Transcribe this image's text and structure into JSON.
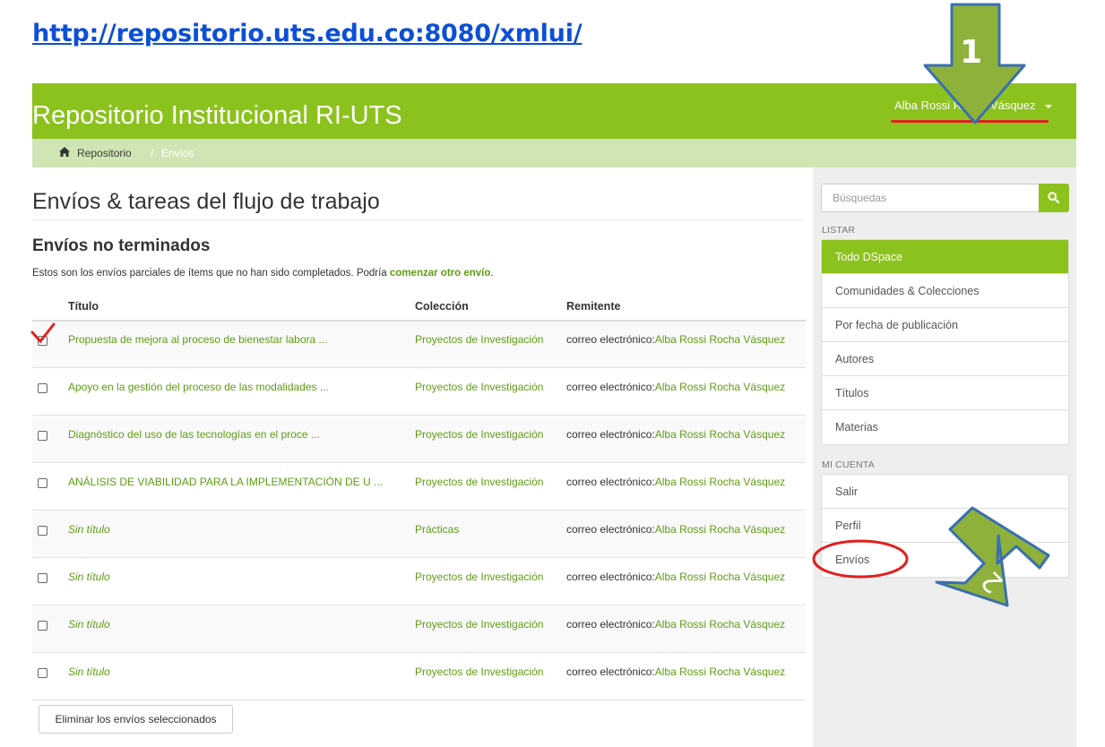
{
  "url_banner": "http://repositorio.uts.edu.co:8080/xmlui/",
  "header": {
    "brand": "Repositorio Institucional RI-UTS",
    "user_name": "Alba Rossi Rocha Vásquez",
    "accent_color": "#8cc21d"
  },
  "breadcrumb": {
    "home_icon": "home-icon",
    "items": [
      "Repositorio",
      "/",
      "Envíos"
    ]
  },
  "main": {
    "page_title": "Envíos & tareas del flujo de trabajo",
    "section_title": "Envíos no terminados",
    "intro_text": "Estos son los envíos parciales de ítems que no han sido completados. Podría ",
    "intro_link": "comenzar otro envío",
    "intro_end": ".",
    "columns": [
      "Título",
      "Colección",
      "Remitente"
    ],
    "rows": [
      {
        "title": "Propuesta de mejora al proceso de bienestar labora ...",
        "collection": "Proyectos de Investigación",
        "sender_prefix": "correo electrónico:",
        "sender_name": "Alba Rossi Rocha Vásquez"
      },
      {
        "title": "Apoyo en la gestión del proceso de las modalidades ...",
        "collection": "Proyectos de Investigación",
        "sender_prefix": "correo electrónico:",
        "sender_name": "Alba Rossi Rocha Vásquez"
      },
      {
        "title": "Diagnóstico del uso de las tecnologías en el proce ...",
        "collection": "Proyectos de Investigación",
        "sender_prefix": "correo electrónico:",
        "sender_name": "Alba Rossi Rocha Vásquez"
      },
      {
        "title": "ANÁLISIS DE VIABILIDAD PARA LA IMPLEMENTACIÓN DE U ...",
        "collection": "Proyectos de Investigación",
        "sender_prefix": "correo electrónico:",
        "sender_name": "Alba Rossi Rocha Vásquez"
      },
      {
        "title": "Sin título",
        "collection": "Prácticas",
        "sender_prefix": "correo electrónico:",
        "sender_name": "Alba Rossi Rocha Vásquez"
      },
      {
        "title": "Sin título",
        "collection": "Proyectos de Investigación",
        "sender_prefix": "correo electrónico:",
        "sender_name": "Alba Rossi Rocha Vásquez"
      },
      {
        "title": "Sin título",
        "collection": "Proyectos de Investigación",
        "sender_prefix": "correo electrónico:",
        "sender_name": "Alba Rossi Rocha Vásquez"
      },
      {
        "title": "Sin título",
        "collection": "Proyectos de Investigación",
        "sender_prefix": "correo electrónico:",
        "sender_name": "Alba Rossi Rocha Vásquez"
      }
    ],
    "delete_button": "Eliminar los envíos seleccionados"
  },
  "sidebar": {
    "search_placeholder": "Búsquedas",
    "search_icon": "search-icon",
    "browse_heading": "LISTAR",
    "browse_items": [
      "Todo DSpace",
      "Comunidades & Colecciones",
      "Por fecha de publicación",
      "Autores",
      "Títulos",
      "Materias"
    ],
    "account_heading": "MI CUENTA",
    "account_items": [
      "Salir",
      "Perfil",
      "Envíos"
    ]
  },
  "annotations": {
    "marker_1": "1",
    "marker_2": "2",
    "arrow_color": "#8db13a",
    "arrow_border_color": "#3a6fb0",
    "highlight_color": "#e02020"
  }
}
